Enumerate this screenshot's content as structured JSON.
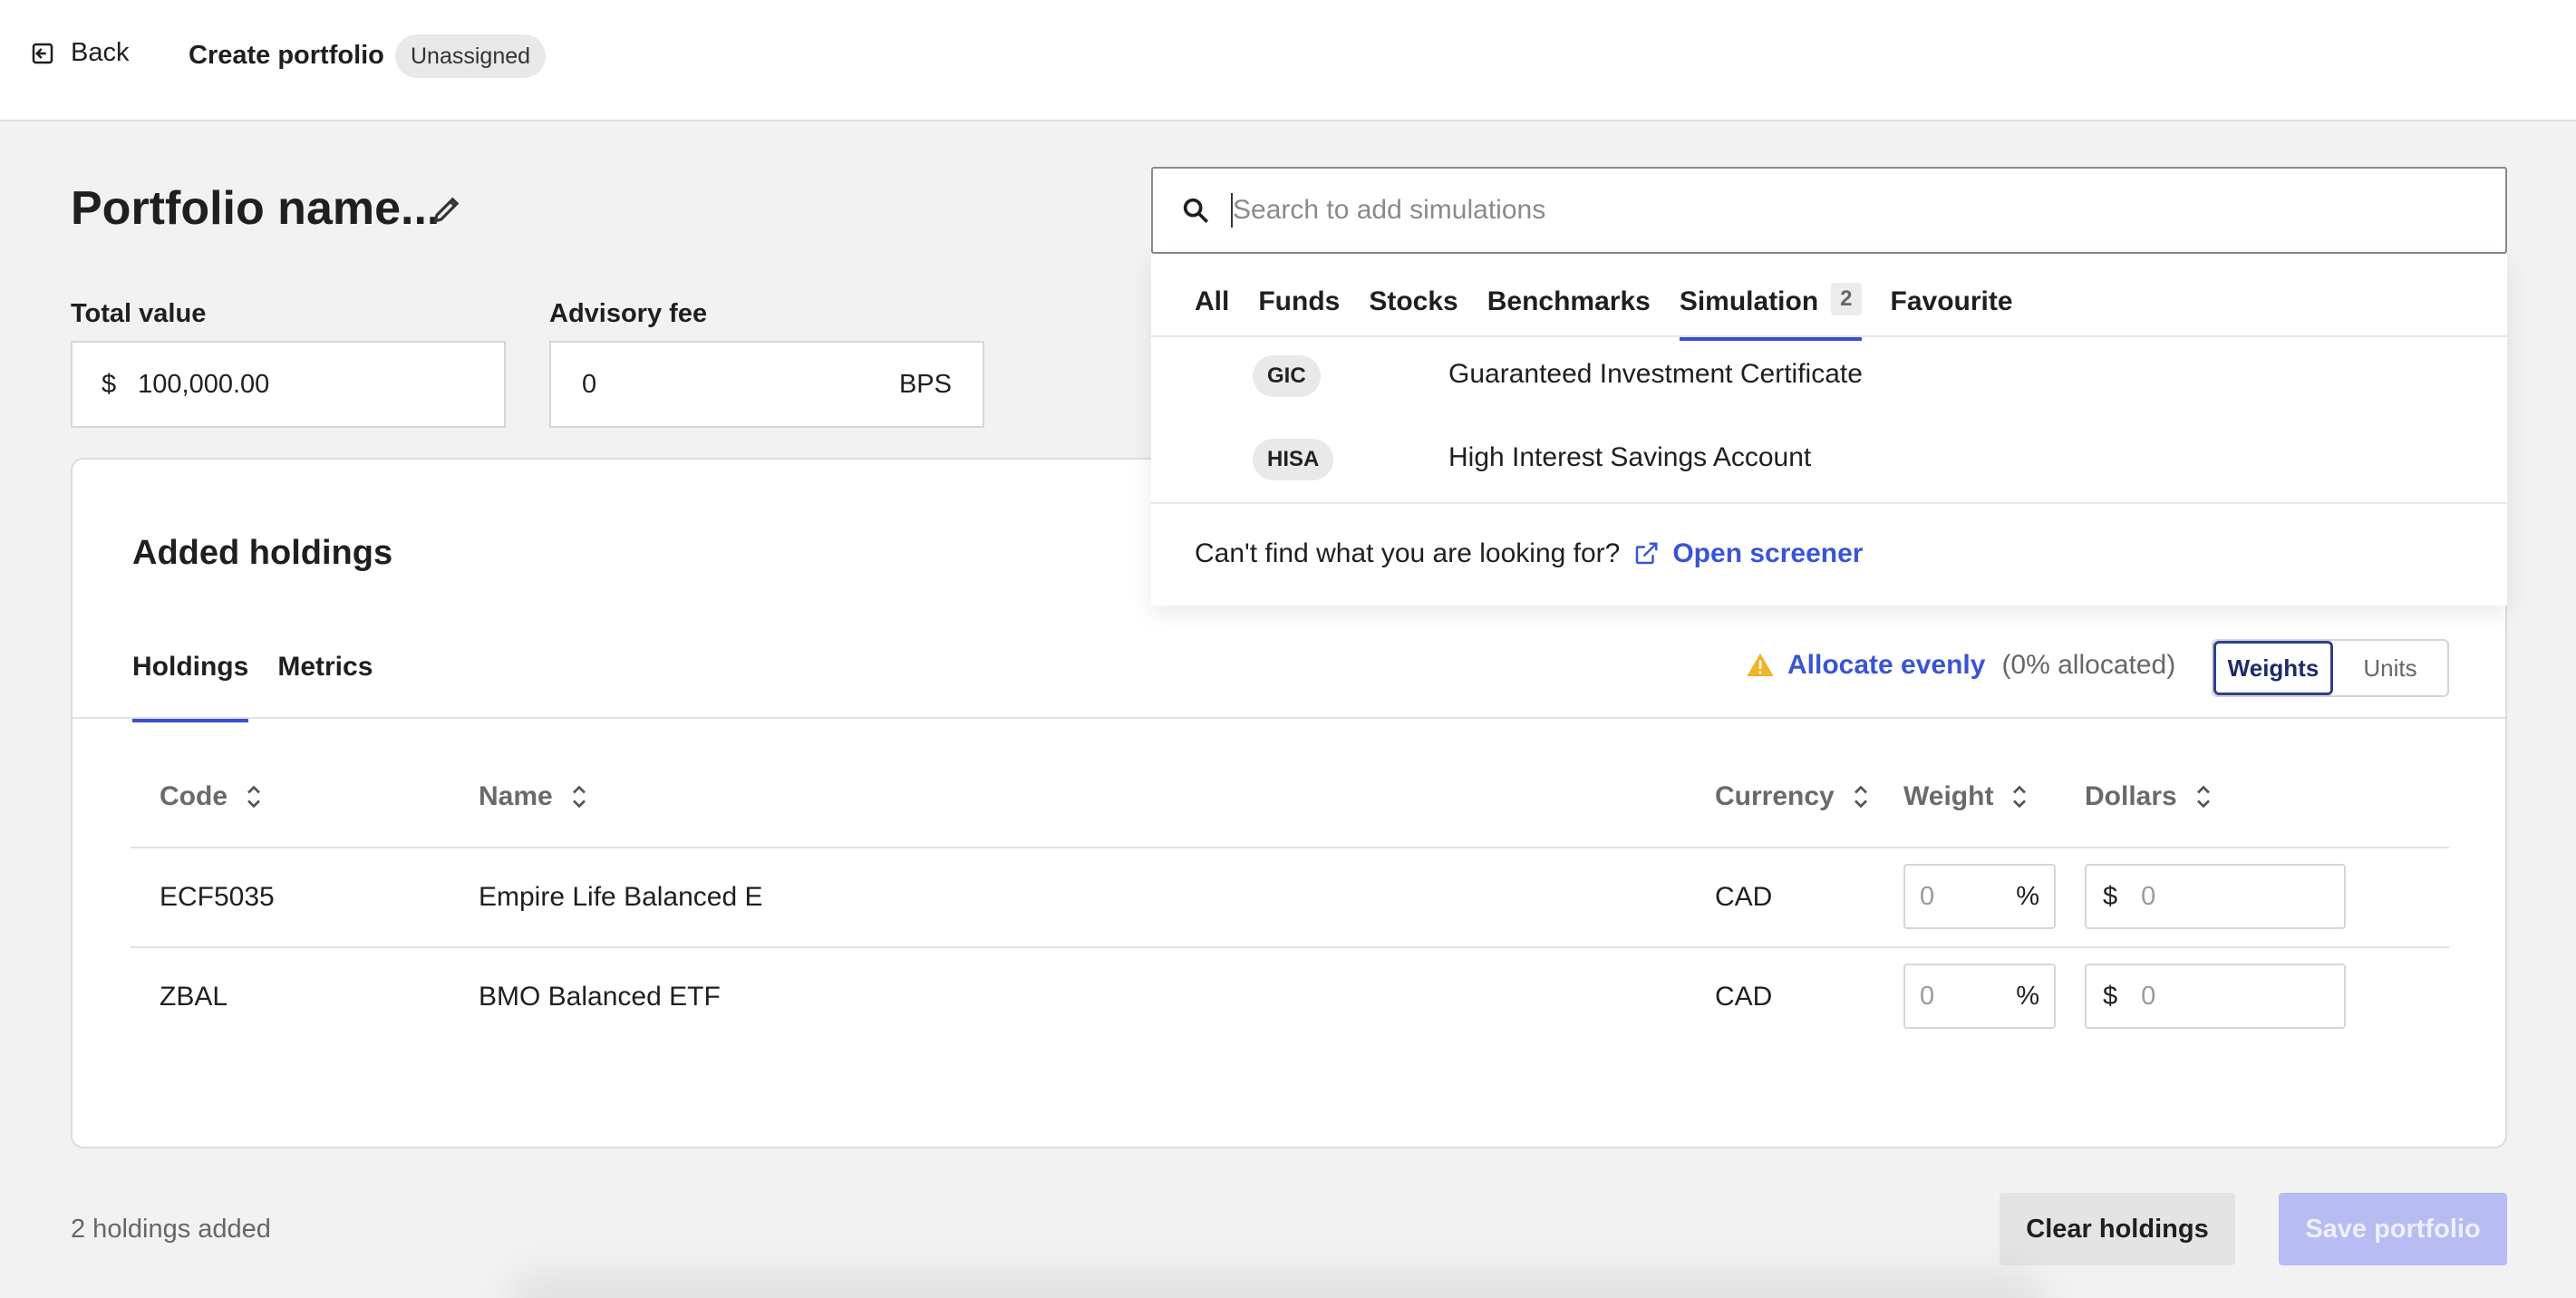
{
  "header": {
    "back_label": "Back",
    "title": "Create portfolio",
    "status_badge": "Unassigned"
  },
  "portfolio": {
    "name_placeholder": "Portfolio name...",
    "total_value": {
      "label": "Total value",
      "currency_symbol": "$",
      "value": "100,000.00"
    },
    "advisory_fee": {
      "label": "Advisory fee",
      "value": "0",
      "unit": "BPS"
    }
  },
  "holdings_card": {
    "title": "Added holdings",
    "tabs": [
      {
        "label": "Holdings",
        "active": true
      },
      {
        "label": "Metrics",
        "active": false
      }
    ],
    "allocate_label": "Allocate evenly",
    "allocated_text": "(0% allocated)",
    "toggle": {
      "weights": "Weights",
      "units": "Units",
      "selected": "Weights"
    },
    "columns": [
      "Code",
      "Name",
      "Currency",
      "Weight",
      "Dollars"
    ],
    "rows": [
      {
        "code": "ECF5035",
        "name": "Empire Life Balanced E",
        "currency": "CAD",
        "weight_placeholder": "0",
        "weight_unit": "%",
        "dollar_symbol": "$",
        "dollars_placeholder": "0"
      },
      {
        "code": "ZBAL",
        "name": "BMO Balanced ETF",
        "currency": "CAD",
        "weight_placeholder": "0",
        "weight_unit": "%",
        "dollar_symbol": "$",
        "dollars_placeholder": "0"
      }
    ]
  },
  "footer": {
    "count_text": "2 holdings added",
    "clear_label": "Clear holdings",
    "save_label": "Save portfolio"
  },
  "search": {
    "placeholder": "Search to add simulations",
    "tabs": [
      {
        "label": "All"
      },
      {
        "label": "Funds"
      },
      {
        "label": "Stocks"
      },
      {
        "label": "Benchmarks"
      },
      {
        "label": "Simulation",
        "count": "2",
        "active": true
      },
      {
        "label": "Favourite"
      }
    ],
    "results": [
      {
        "code": "GIC",
        "name": "Guaranteed Investment Certificate"
      },
      {
        "code": "HISA",
        "name": "High Interest Savings Account"
      }
    ],
    "footer_text": "Can't find what you are looking for?",
    "screener_label": "Open screener"
  },
  "colors": {
    "accent": "#3a4fd1",
    "link": "#3a55d3",
    "warning": "#f0b429",
    "save_disabled": "#b7bcf2",
    "background": "#f2f2f2"
  },
  "icons": [
    "back-icon",
    "pencil-icon",
    "warning-icon",
    "sort-icon",
    "search-icon",
    "external-link-icon"
  ]
}
